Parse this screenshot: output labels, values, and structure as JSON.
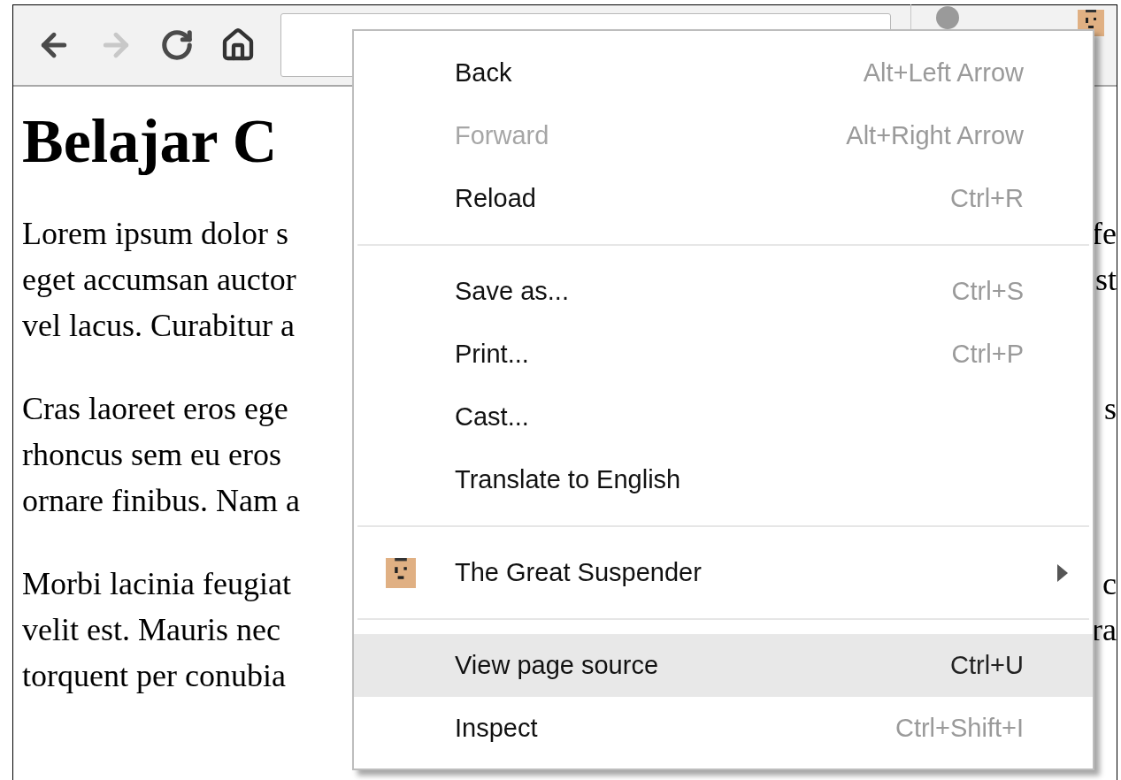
{
  "toolbar": {
    "back": {
      "disabled": false
    },
    "forward": {
      "disabled": true
    }
  },
  "page": {
    "heading": "Belajar C",
    "paragraphs": [
      {
        "lines": [
          {
            "left": "Lorem ipsum dolor s",
            "right": "fe"
          },
          {
            "left": "eget accumsan auctor",
            "right": "st"
          },
          {
            "left": "vel lacus. Curabitur a"
          }
        ]
      },
      {
        "lines": [
          {
            "left": "Cras laoreet eros ege",
            "right": "s"
          },
          {
            "left": "rhoncus sem eu eros"
          },
          {
            "left": "ornare finibus. Nam a"
          }
        ]
      },
      {
        "lines": [
          {
            "left": "Morbi lacinia feugiat",
            "right": "c"
          },
          {
            "left": "velit est. Mauris nec",
            "right": "ra"
          },
          {
            "left": "torquent per conubia"
          }
        ]
      }
    ]
  },
  "context_menu": {
    "items": [
      {
        "kind": "item",
        "label": "Back",
        "shortcut": "Alt+Left Arrow",
        "disabled": false,
        "selected": false
      },
      {
        "kind": "item",
        "label": "Forward",
        "shortcut": "Alt+Right Arrow",
        "disabled": true,
        "selected": false
      },
      {
        "kind": "item",
        "label": "Reload",
        "shortcut": "Ctrl+R",
        "disabled": false,
        "selected": false
      },
      {
        "kind": "separator"
      },
      {
        "kind": "item",
        "label": "Save as...",
        "shortcut": "Ctrl+S",
        "disabled": false,
        "selected": false
      },
      {
        "kind": "item",
        "label": "Print...",
        "shortcut": "Ctrl+P",
        "disabled": false,
        "selected": false
      },
      {
        "kind": "item",
        "label": "Cast...",
        "disabled": false,
        "selected": false
      },
      {
        "kind": "item",
        "label": "Translate to English",
        "disabled": false,
        "selected": false
      },
      {
        "kind": "separator"
      },
      {
        "kind": "submenu",
        "label": "The Great Suspender",
        "disabled": false,
        "selected": false
      },
      {
        "kind": "separator"
      },
      {
        "kind": "item",
        "label": "View page source",
        "shortcut": "Ctrl+U",
        "disabled": false,
        "selected": true
      },
      {
        "kind": "item",
        "label": "Inspect",
        "shortcut": "Ctrl+Shift+I",
        "disabled": false,
        "selected": false
      }
    ]
  }
}
